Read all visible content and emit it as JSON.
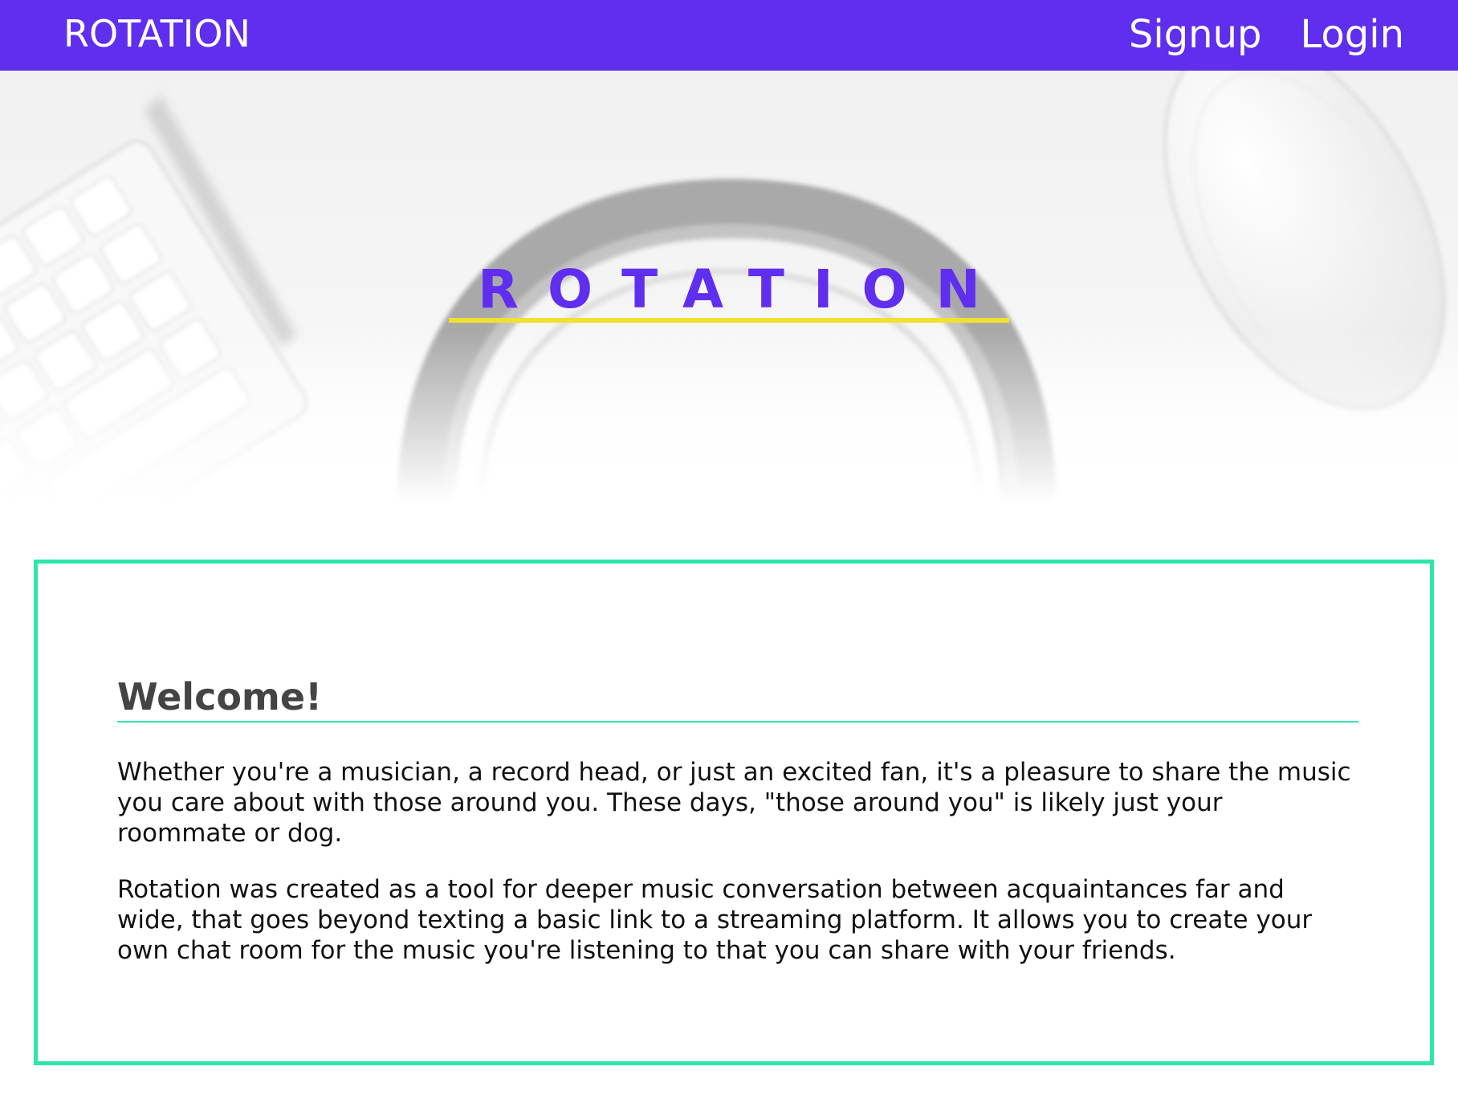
{
  "navbar": {
    "brand": "ROTATION",
    "links": [
      {
        "label": "Signup"
      },
      {
        "label": "Login"
      }
    ],
    "color": "#5f2eee"
  },
  "hero": {
    "title": "ROTATION",
    "title_color": "#5f2eee",
    "underline_color": "#f2e030",
    "background": "blurred desk photo with keyboard, headphones and mouse"
  },
  "welcome": {
    "heading": "Welcome!",
    "paragraphs": [
      "Whether you're a musician, a record head, or just an excited fan, it's a pleasure to share the music you care about with those around you. These days, \"those around you\" is likely just your roommate or dog.",
      "Rotation was created as a tool for deeper music conversation between acquaintances far and wide, that goes beyond texting a basic link to a streaming platform. It allows you to create your own chat room for the music you're listening to that you can share with your friends."
    ],
    "border_color": "#2ee6aa"
  }
}
